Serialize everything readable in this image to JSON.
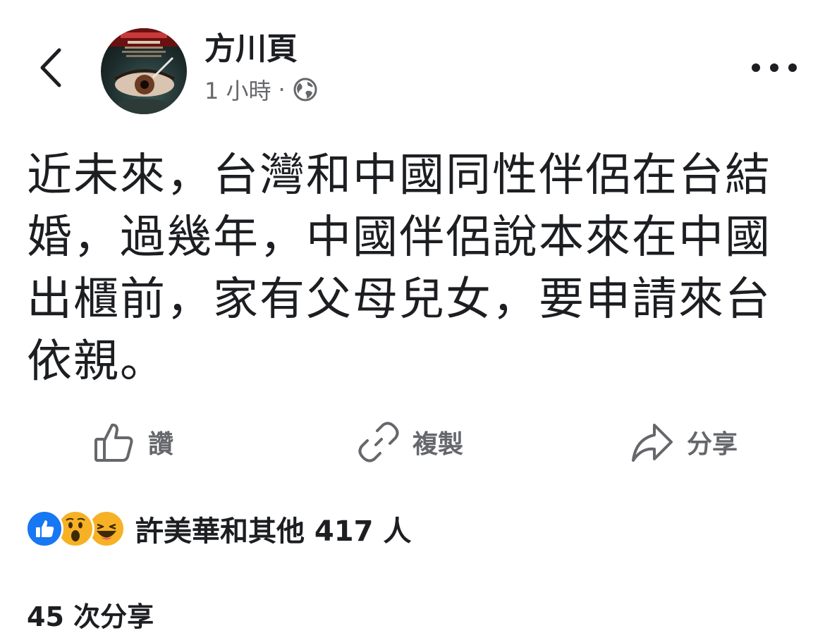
{
  "header": {
    "author_name": "方川頁",
    "time_ago": "1 小時",
    "separator": "·",
    "audience_icon": "globe-icon",
    "back_icon": "chevron-left-icon",
    "more_icon": "ellipsis-icon"
  },
  "post": {
    "text": "近未來，台灣和中國同性伴侶在台結婚，過幾年，中國伴侶說本來在中國出櫃前，家有父母兒女，要申請來台依親。"
  },
  "actions": {
    "like_label": "讚",
    "copy_label": "複製",
    "share_label": "分享"
  },
  "reactions": {
    "summary": "許美華和其他 417 人",
    "icons": [
      "like-reaction-icon",
      "wow-reaction-icon",
      "haha-reaction-icon"
    ]
  },
  "shares": {
    "count_text": "45 次分享"
  },
  "colors": {
    "primary_text": "#1c1e21",
    "secondary_text": "#65676b",
    "like_blue": "#1877f2",
    "emoji_yellow": "#f7b125"
  }
}
